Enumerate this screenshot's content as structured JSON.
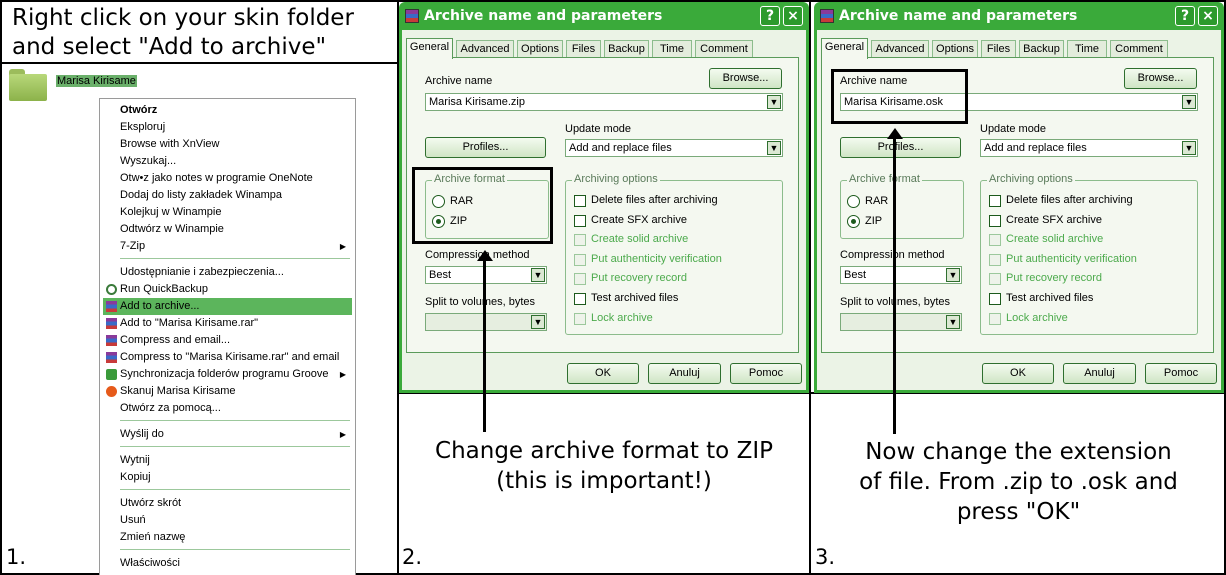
{
  "panel1": {
    "title_line1": "Right click on your skin folder",
    "title_line2": "and select \"Add to archive\"",
    "folder_label": "Marisa Kirisame",
    "step": "1.",
    "menu": [
      {
        "label": "Otwórz",
        "bold": true
      },
      {
        "label": "Eksploruj"
      },
      {
        "label": "Browse with XnView"
      },
      {
        "label": "Wyszukaj..."
      },
      {
        "label": "Otw•z jako notes w programie OneNote"
      },
      {
        "label": "Dodaj do listy zakładek Winampa"
      },
      {
        "label": "Kolejkuj w Winampie"
      },
      {
        "label": "Odtwórz w Winampie"
      },
      {
        "label": "7-Zip",
        "submenu": true
      },
      {
        "separator": true
      },
      {
        "label": "Udostępnianie i zabezpieczenia..."
      },
      {
        "label": "Run QuickBackup",
        "icon": "quickbackup-icon"
      },
      {
        "label": "Add to archive...",
        "icon": "winrar-icon",
        "highlighted": true
      },
      {
        "label": "Add to \"Marisa Kirisame.rar\"",
        "icon": "winrar-icon"
      },
      {
        "label": "Compress and email...",
        "icon": "winrar-icon"
      },
      {
        "label": "Compress to \"Marisa Kirisame.rar\" and email",
        "icon": "winrar-icon"
      },
      {
        "label": "Synchronizacja folderów programu Groove",
        "icon": "groove-icon",
        "submenu": true
      },
      {
        "label": "Skanuj Marisa Kirisame",
        "icon": "antivirus-scan-icon"
      },
      {
        "label": "Otwórz za pomocą..."
      },
      {
        "separator": true
      },
      {
        "label": "Wyślij do",
        "submenu": true
      },
      {
        "separator": true
      },
      {
        "label": "Wytnij"
      },
      {
        "label": "Kopiuj"
      },
      {
        "separator": true
      },
      {
        "label": "Utwórz skrót"
      },
      {
        "label": "Usuń"
      },
      {
        "label": "Zmień nazwę"
      },
      {
        "separator": true
      },
      {
        "label": "Właściwości"
      }
    ]
  },
  "dialog": {
    "title": "Archive name and parameters",
    "help_btn": "?",
    "close_btn": "×",
    "tabs": [
      "General",
      "Advanced",
      "Options",
      "Files",
      "Backup",
      "Time",
      "Comment"
    ],
    "archive_name_label": "Archive name",
    "browse_btn": "Browse...",
    "profiles_btn": "Profiles...",
    "update_mode_label": "Update mode",
    "update_mode_value": "Add and replace files",
    "archive_format_label": "Archive format",
    "format_rar": "RAR",
    "format_zip": "ZIP",
    "compression_label": "Compression method",
    "compression_value": "Best",
    "split_label": "Split to volumes, bytes",
    "options_label": "Archiving options",
    "options": [
      {
        "label": "Delete files after archiving",
        "enabled": true
      },
      {
        "label": "Create SFX archive",
        "enabled": true
      },
      {
        "label": "Create solid archive",
        "enabled": false
      },
      {
        "label": "Put authenticity verification",
        "enabled": false
      },
      {
        "label": "Put recovery record",
        "enabled": false
      },
      {
        "label": "Test archived files",
        "enabled": true
      },
      {
        "label": "Lock archive",
        "enabled": false
      }
    ],
    "ok_btn": "OK",
    "cancel_btn": "Anuluj",
    "help_bottom_btn": "Pomoc"
  },
  "panel2": {
    "archive_name_value": "Marisa Kirisame.zip",
    "caption_line1": "Change archive format to ZIP",
    "caption_line2": "(this is important!)",
    "step": "2."
  },
  "panel3": {
    "archive_name_value": "Marisa Kirisame.osk",
    "caption_line1": "Now change the extension",
    "caption_line2": "of file. From .zip to .osk and",
    "caption_line3": "press \"OK\"",
    "step": "3."
  },
  "colors": {
    "dialog_frame": "#3aaa3a",
    "menu_highlight": "#5cb55c",
    "disabled_text": "#4caa4c"
  }
}
